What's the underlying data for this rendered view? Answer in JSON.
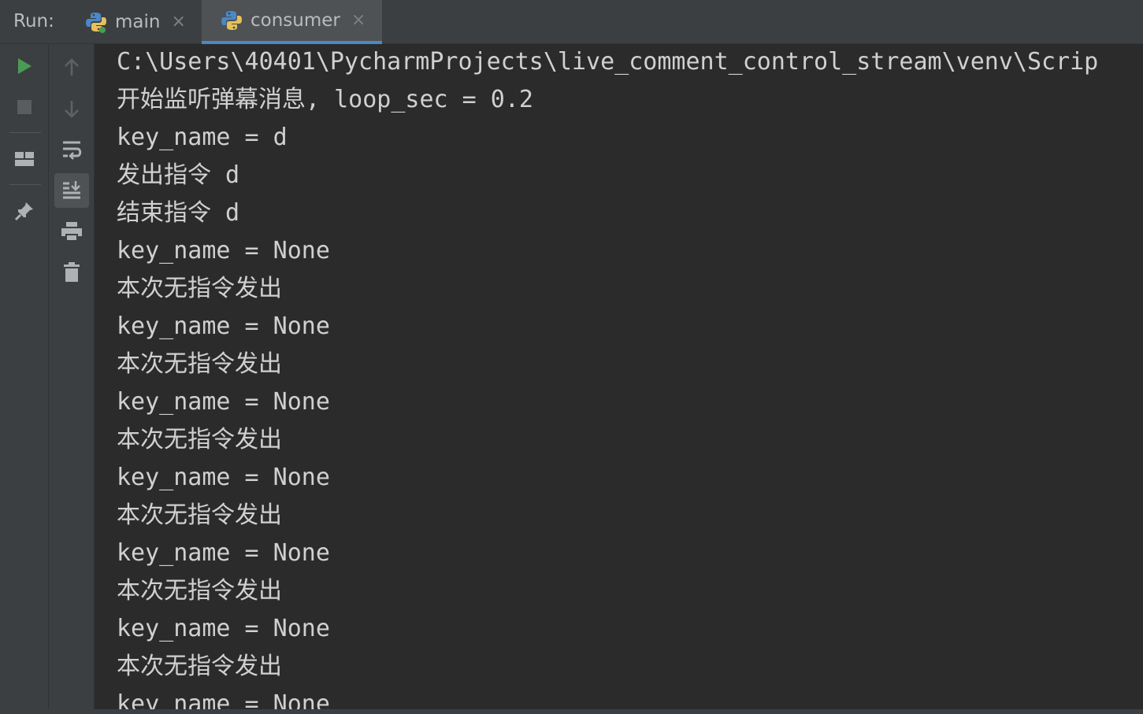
{
  "run_label": "Run:",
  "tabs": [
    {
      "label": "main",
      "active": false
    },
    {
      "label": "consumer",
      "active": true
    }
  ],
  "close_glyph": "×",
  "left_toolbar": [
    {
      "icon": "play-icon",
      "color": "#499c54"
    },
    {
      "icon": "stop-icon"
    },
    {
      "icon": "layout-icon"
    },
    {
      "icon": "pin-icon"
    }
  ],
  "right_toolbar": [
    {
      "icon": "arrow-up-icon"
    },
    {
      "icon": "arrow-down-icon"
    },
    {
      "icon": "soft-wrap-icon"
    },
    {
      "icon": "scroll-to-end-icon",
      "selected": true
    },
    {
      "icon": "print-icon"
    },
    {
      "icon": "trash-icon"
    }
  ],
  "console_lines": [
    "C:\\Users\\40401\\PycharmProjects\\live_comment_control_stream\\venv\\Scrip",
    "开始监听弹幕消息, loop_sec = 0.2",
    "key_name = d",
    "发出指令 d",
    "结束指令 d",
    "key_name = None",
    "本次无指令发出",
    "key_name = None",
    "本次无指令发出",
    "key_name = None",
    "本次无指令发出",
    "key_name = None",
    "本次无指令发出",
    "key_name = None",
    "本次无指令发出",
    "key_name = None",
    "本次无指令发出",
    "key_name = None"
  ],
  "colors": {
    "background": "#2b2b2b",
    "panel": "#3c3f41",
    "text": "#d0d0d0",
    "accent": "#4a88c7",
    "run_green": "#499c54"
  }
}
